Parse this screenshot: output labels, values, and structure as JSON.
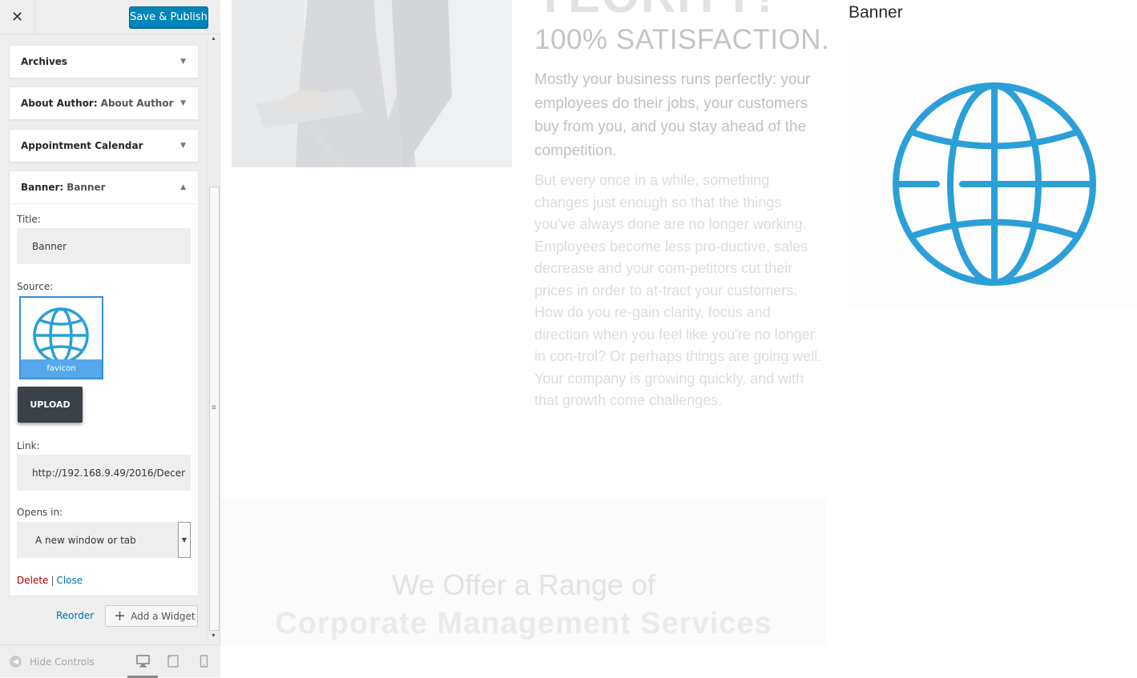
{
  "header": {
    "close_glyph": "✕",
    "publish_label": "Save & Publish"
  },
  "widgets": [
    {
      "title": "Archives",
      "subtitle": ""
    },
    {
      "title": "About Author:",
      "subtitle": "About Author"
    },
    {
      "title": "Appointment Calendar",
      "subtitle": ""
    },
    {
      "title": "Banner:",
      "subtitle": "Banner"
    }
  ],
  "banner_form": {
    "title_label": "Title:",
    "title_value": "Banner",
    "source_label": "Source:",
    "image_caption": "favicon",
    "upload_label": "UPLOAD",
    "link_label": "Link:",
    "link_value": "http://192.168.9.49/2016/Decer",
    "opens_label": "Opens in:",
    "opens_value": "A new window or tab",
    "delete_label": "Delete",
    "separator": "|",
    "close_label": "Close"
  },
  "sidebar_footer": {
    "reorder_label": "Reorder",
    "add_widget_label": "Add a Widget",
    "hide_controls_label": "Hide Controls"
  },
  "preview": {
    "big_heading": "YEORITY!",
    "subheading": "100% SATISFACTION.",
    "lead": "Mostly your business runs perfectly: your employees do their jobs, your customers buy from you, and you stay ahead of the competition.",
    "body": "But every once in a while, something changes just enough so that the things you've always done are no longer working. Employees become less pro-ductive, sales decrease and your com-petitors cut their prices in order to at-tract your customers. How do you re-gain clarity, focus and direction when you feel like you're no longer in con-trol? Or perhaps things are going well. Your company is growing quickly, and with that growth come challenges.",
    "banner_title": "Banner",
    "offer_line1": "We Offer a Range of",
    "offer_line2": "Corporate Management Services"
  },
  "colors": {
    "accent": "#0085ba",
    "globe": "#2a9fd8",
    "delete": "#aa0000",
    "link": "#0073aa"
  }
}
